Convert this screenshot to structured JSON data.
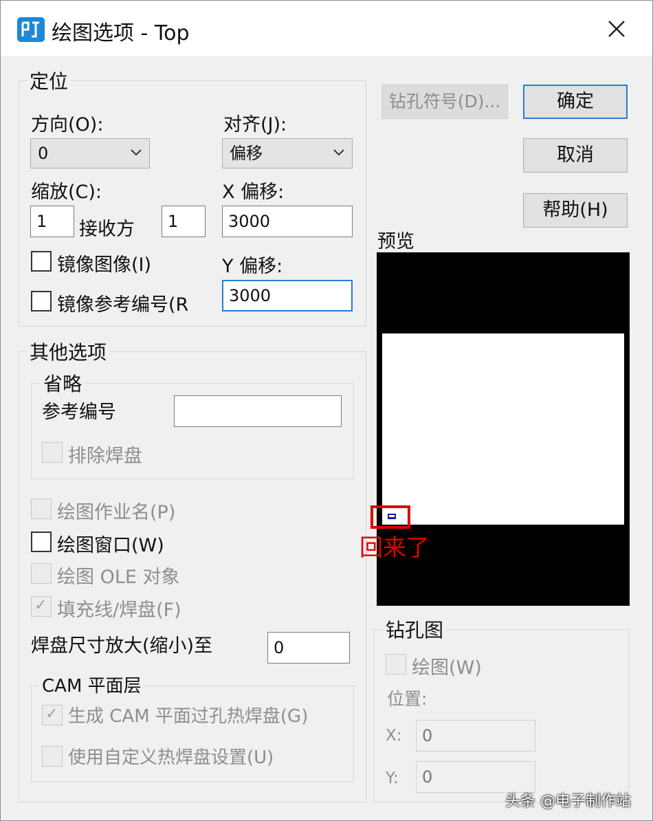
{
  "titlebar": {
    "title": "绘图选项 - Top",
    "close_icon": "close-icon"
  },
  "positioning": {
    "title": "定位",
    "orientation_label": "方向(O):",
    "orientation_value": "0",
    "align_label": "对齐(J):",
    "align_value": "偏移",
    "scale_label": "缩放(C):",
    "scale_x": "1",
    "receive_label": "接收方",
    "scale_y": "1",
    "x_offset_label": "X 偏移:",
    "x_offset_value": "3000",
    "y_offset_label": "Y 偏移:",
    "y_offset_value": "3000",
    "mirror_image_label": "镜像图像(I)",
    "mirror_image_checked": false,
    "mirror_ref_label": "镜像参考编号(R",
    "mirror_ref_checked": false
  },
  "other_options": {
    "title": "其他选项",
    "omit_title": "省略",
    "ref_des_label": "参考编号",
    "ref_des_value": "",
    "exclude_pads_label": "排除焊盘",
    "plot_job_name_label": "绘图作业名(P)",
    "plot_window_label": "绘图窗口(W)",
    "plot_ole_label": "绘图 OLE 对象",
    "fill_lines_label": "填充线/焊盘(F)",
    "fill_lines_checked": true,
    "pad_scale_label": "焊盘尺寸放大(缩小)至",
    "pad_scale_value": "0",
    "cam_title": "CAM 平面层",
    "cam_thermal_label": "生成 CAM 平面过孔热焊盘(G)",
    "cam_thermal_checked": true,
    "custom_thermal_label": "使用自定义热焊盘设置(U)"
  },
  "buttons": {
    "drill_symbol": "钻孔符号(D)...",
    "ok": "确定",
    "cancel": "取消",
    "help": "帮助(H)"
  },
  "preview": {
    "label": "预览",
    "annotation": "回来了"
  },
  "drill_drawing": {
    "title": "钻孔图",
    "draw_label": "绘图(W)",
    "position_label": "位置:",
    "x_label": "X:",
    "x_value": "0",
    "y_label": "Y:",
    "y_value": "0"
  },
  "footer": {
    "text": "头条 @电子制作站"
  },
  "colors": {
    "accent": "#2a7ad5",
    "annotation": "#e00000",
    "preview_bg": "#000000"
  }
}
